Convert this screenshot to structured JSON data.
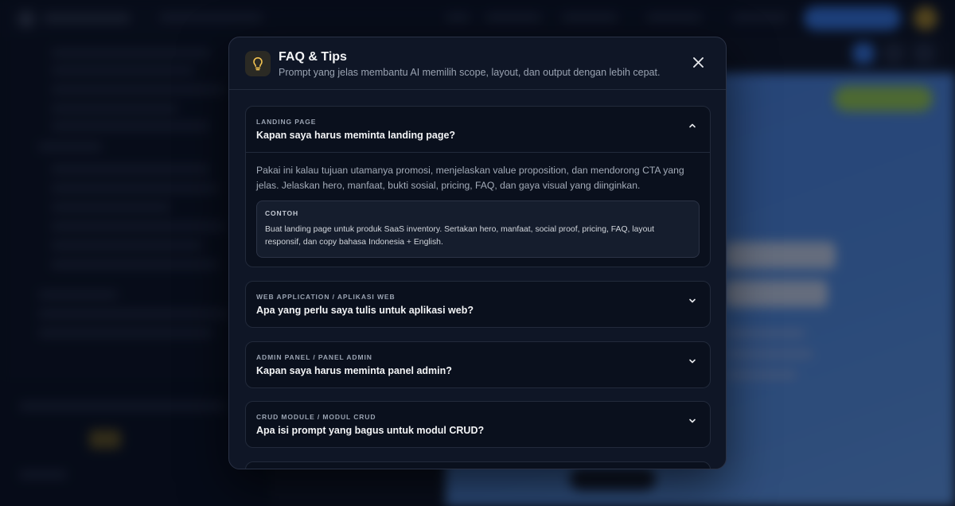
{
  "modal": {
    "title": "FAQ & Tips",
    "subtitle": "Prompt yang jelas membantu AI memilih scope, layout, dan output dengan lebih cepat.",
    "header_icon": "lightbulb-icon",
    "close_icon": "close-icon",
    "accent_color": "#f5c451"
  },
  "faq": {
    "items": [
      {
        "category": "LANDING PAGE",
        "question": "Kapan saya harus meminta landing page?",
        "expanded": true,
        "answer": "Pakai ini kalau tujuan utamanya promosi, menjelaskan value proposition, dan mendorong CTA yang jelas. Jelaskan hero, manfaat, bukti sosial, pricing, FAQ, dan gaya visual yang diinginkan.",
        "example_label": "CONTOH",
        "example_text": "Buat landing page untuk produk SaaS inventory. Sertakan hero, manfaat, social proof, pricing, FAQ, layout responsif, dan copy bahasa Indonesia + English."
      },
      {
        "category": "WEB APPLICATION / APLIKASI WEB",
        "question": "Apa yang perlu saya tulis untuk aplikasi web?",
        "expanded": false
      },
      {
        "category": "ADMIN PANEL / PANEL ADMIN",
        "question": "Kapan saya harus meminta panel admin?",
        "expanded": false
      },
      {
        "category": "CRUD MODULE / MODUL CRUD",
        "question": "Apa isi prompt yang bagus untuk modul CRUD?",
        "expanded": false
      }
    ]
  }
}
